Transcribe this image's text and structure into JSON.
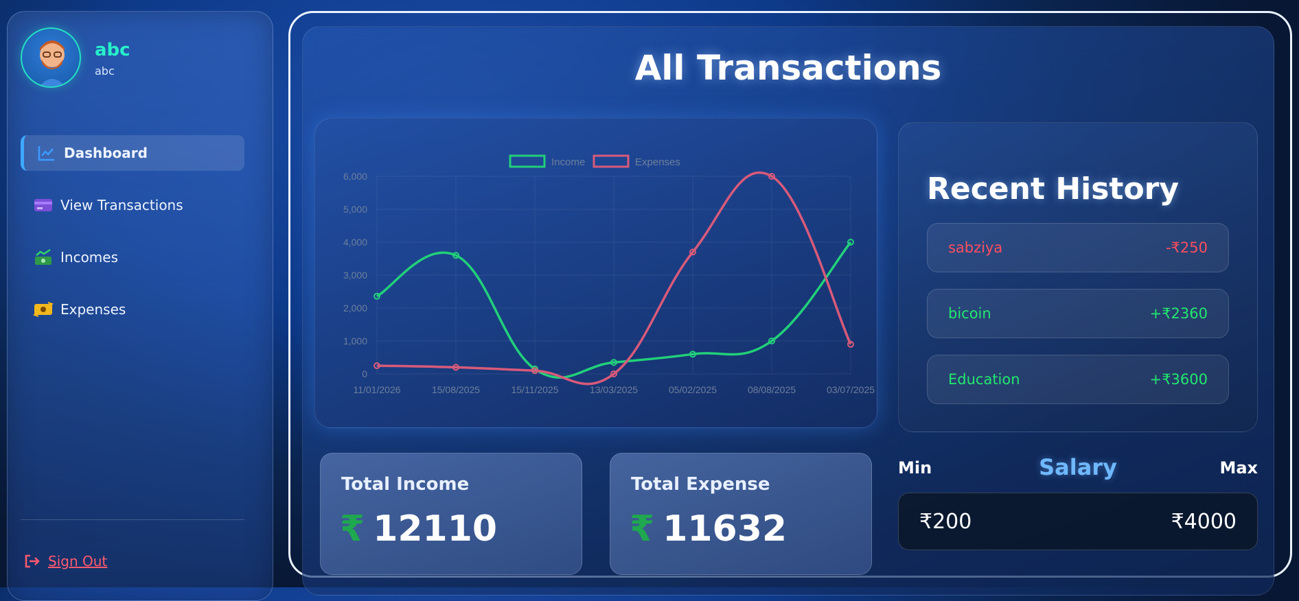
{
  "user": {
    "name": "abc",
    "subtitle": "abc"
  },
  "sidebar": {
    "items": [
      {
        "label": "Dashboard",
        "icon": "chart-line-icon",
        "active": true
      },
      {
        "label": "View Transactions",
        "icon": "credit-card-icon",
        "active": false
      },
      {
        "label": "Incomes",
        "icon": "money-trend-icon",
        "active": false
      },
      {
        "label": "Expenses",
        "icon": "money-exchange-icon",
        "active": false
      }
    ],
    "signout_label": "Sign Out"
  },
  "page": {
    "title": "All Transactions"
  },
  "chart_data": {
    "type": "line",
    "categories": [
      "11/01/2026",
      "15/08/2025",
      "15/11/2025",
      "13/03/2025",
      "05/02/2025",
      "08/08/2025",
      "03/07/2025"
    ],
    "series": [
      {
        "name": "Income",
        "color": "#22d07a",
        "values": [
          2360,
          3600,
          150,
          350,
          600,
          1000,
          4000
        ]
      },
      {
        "name": "Expenses",
        "color": "#d85a7a",
        "values": [
          250,
          200,
          100,
          0,
          3700,
          6000,
          900
        ]
      }
    ],
    "ylim": [
      0,
      6000
    ],
    "yticks": [
      "0",
      "1,000",
      "2,000",
      "3,000",
      "4,000",
      "5,000",
      "6,000"
    ],
    "grid": true,
    "legend": "top-center"
  },
  "history": {
    "title": "Recent History",
    "items": [
      {
        "name": "sabziya",
        "amount": "-₹250",
        "color": "#ff4d5e"
      },
      {
        "name": "bicoin",
        "amount": "+₹2360",
        "color": "#22e86f"
      },
      {
        "name": "Education",
        "amount": "+₹3600",
        "color": "#22e86f"
      }
    ]
  },
  "totals": {
    "income_label": "Total Income",
    "income_value": "12110",
    "expense_label": "Total Expense",
    "expense_value": "11632",
    "currency_symbol": "₹"
  },
  "salary": {
    "min_label": "Min",
    "title": "Salary",
    "max_label": "Max",
    "min_value": "₹200",
    "max_value": "₹4000"
  }
}
